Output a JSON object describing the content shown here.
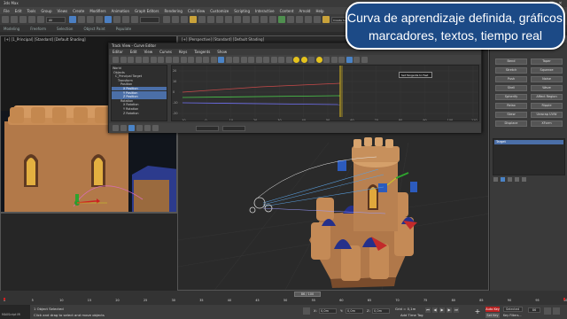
{
  "window": {
    "title": "3ds Max"
  },
  "menubar": [
    "File",
    "Edit",
    "Tools",
    "Group",
    "Views",
    "Create",
    "Modifiers",
    "Animation",
    "Graph Editors",
    "Rendering",
    "Civil View",
    "Customize",
    "Scripting",
    "Interactive",
    "Content",
    "Arnold",
    "Help"
  ],
  "main_toolbar": {
    "filter_value": "All",
    "selection_set": "Create Selection Se"
  },
  "ribbon": [
    "Modeling",
    "Freeform",
    "Selection",
    "Object Paint",
    "Populate"
  ],
  "viewports": {
    "left_label": "[+] [1_Principal] [Standard] [Default Shading]",
    "perspective_label": "[+] [Perspective] [Standard] [Default Shading]"
  },
  "curve_editor": {
    "title": "Track View - Curve Editor",
    "menu": [
      "Editor",
      "Edit",
      "View",
      "Curves",
      "Keys",
      "Tangents",
      "Show"
    ],
    "tooltip": "Set Tangents to Fast",
    "tree": [
      "World",
      "Objects",
      "C_Principal Target",
      "Transform",
      "Position",
      "X Position",
      "Y Position",
      "Z Position",
      "Rotation",
      "X Rotation",
      "Y Rotation",
      "Z Rotation"
    ],
    "selected_tree_items": [
      "X Position",
      "Y Position",
      "Z Position"
    ],
    "graph_values": [
      "20",
      "10",
      "0",
      "-10",
      "-20"
    ],
    "graph_frames": [
      "-10",
      "0",
      "10",
      "20",
      "30",
      "40",
      "50",
      "60",
      "70",
      "80",
      "90",
      "100",
      "110"
    ]
  },
  "command_panel": {
    "header": "Modifier List",
    "modifiers": [
      "Bend",
      "Taper",
      "Stretch",
      "Squeeze",
      "Push",
      "Noise",
      "Shell",
      "Wave",
      "Spherify",
      "Affect Region",
      "Relax",
      "Ripple",
      "Skew",
      "Unwrap UVW",
      "Displace",
      "XForm"
    ],
    "stack_item": "Target"
  },
  "trackbar": {
    "slider": "86 / 100",
    "ticks": [
      "0",
      "5",
      "10",
      "15",
      "20",
      "25",
      "30",
      "35",
      "40",
      "45",
      "50",
      "55",
      "60",
      "65",
      "70",
      "75",
      "80",
      "85",
      "90",
      "95",
      "100"
    ]
  },
  "status": {
    "objects_selected": "1 Object Selected",
    "prompt": "Click and drag to select and move objects",
    "coords": {
      "x_label": "X:",
      "x": "0,0m",
      "y_label": "Y:",
      "y": "0,0m",
      "z_label": "Z:",
      "z": "0,0m"
    },
    "grid": "Grid = 0,1m",
    "add_time_tag": "Add Time Tag",
    "auto_key": "Auto Key",
    "selected": "Selected",
    "set_key": "Set Key",
    "key_filters": "Key Filters...",
    "frame": "86",
    "script_label": "MAXScript Mi"
  },
  "banner": {
    "line1": "Curva de aprendizaje definida, gráficos,",
    "line2": "marcadores, textos, tiempo real"
  }
}
